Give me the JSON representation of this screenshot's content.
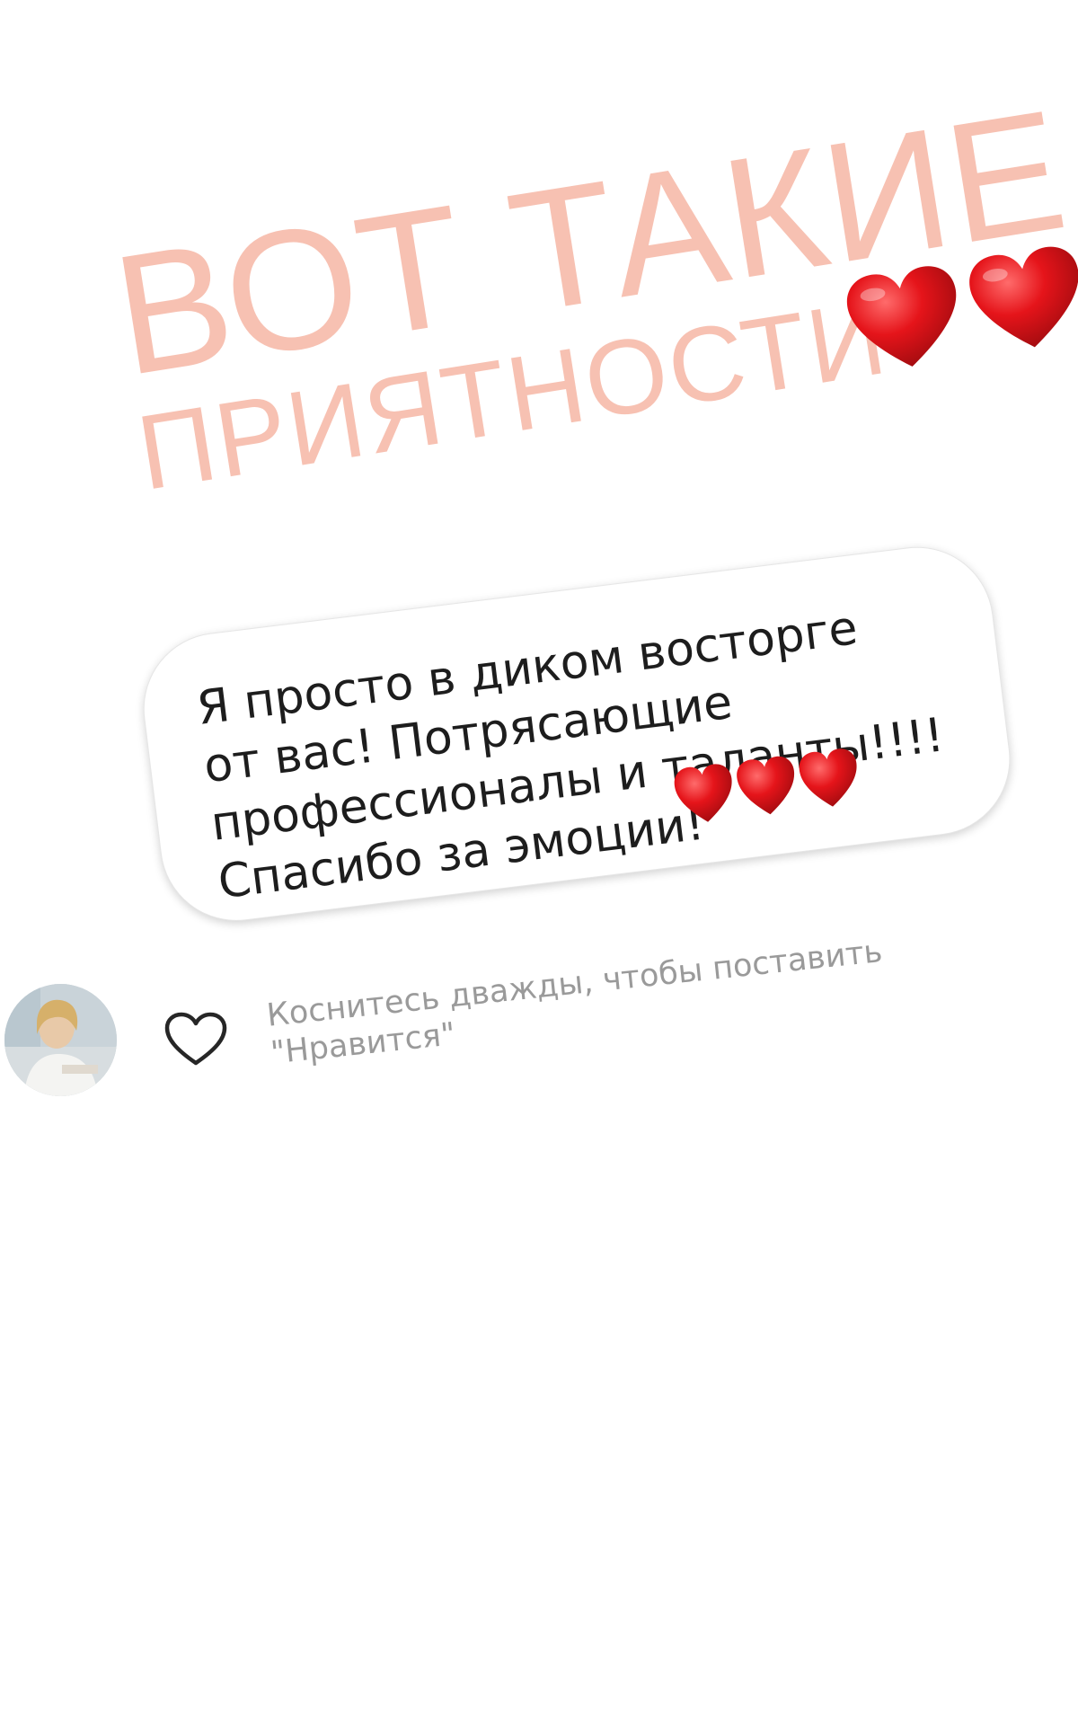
{
  "headline": {
    "line1": "ВОТ ТАКИЕ",
    "line2": "ПРИЯТНОСТИ",
    "heart_icon": "red-heart-icon",
    "heart_count": 2,
    "color": "#f7c1b2"
  },
  "comment": {
    "text": "Я просто в диком восторге\nот вас! Потрясающие\nпрофессионалы и таланты!!!!\nСпасибо за эмоции!",
    "heart_icon": "red-heart-icon",
    "heart_count": 3
  },
  "footer": {
    "avatar_icon": "avatar",
    "like_icon": "heart-outline-icon",
    "hint": "Коснитесь дважды, чтобы поставить \"Нравится\""
  },
  "colors": {
    "heart": "#e5141a",
    "text": "#1d1d1d",
    "hint": "#9a9a9a"
  }
}
